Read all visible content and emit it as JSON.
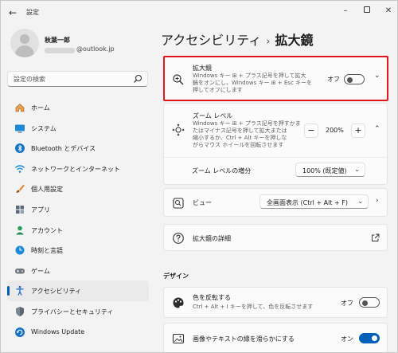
{
  "window": {
    "title": "設定",
    "back_glyph": "←",
    "controls": {
      "minimize": "–",
      "close": "✕"
    }
  },
  "user": {
    "name": "秋葉一郎",
    "email": "@outlook.jp",
    "avatar_icon": "user-avatar-icon"
  },
  "search": {
    "placeholder": "設定の検索",
    "icon": "search-icon"
  },
  "sidebar": {
    "items": [
      {
        "label": "ホーム",
        "icon": "home-icon",
        "active": false
      },
      {
        "label": "システム",
        "icon": "monitor-icon",
        "active": false
      },
      {
        "label": "Bluetooth とデバイス",
        "icon": "bluetooth-icon",
        "active": false
      },
      {
        "label": "ネットワークとインターネット",
        "icon": "wifi-icon",
        "active": false
      },
      {
        "label": "個人用設定",
        "icon": "brush-icon",
        "active": false
      },
      {
        "label": "アプリ",
        "icon": "apps-icon",
        "active": false
      },
      {
        "label": "アカウント",
        "icon": "account-icon",
        "active": false
      },
      {
        "label": "時刻と言語",
        "icon": "globe-clock-icon",
        "active": false
      },
      {
        "label": "ゲーム",
        "icon": "gamepad-icon",
        "active": false
      },
      {
        "label": "アクセシビリティ",
        "icon": "accessibility-icon",
        "active": true
      },
      {
        "label": "プライバシーとセキュリティ",
        "icon": "shield-icon",
        "active": false
      },
      {
        "label": "Windows Update",
        "icon": "update-icon",
        "active": false
      }
    ]
  },
  "breadcrumb": {
    "parent": "アクセシビリティ",
    "separator": "›",
    "current": "拡大鏡"
  },
  "magnifier": {
    "title": "拡大鏡",
    "desc_line1": "Windows キー ⊞ + プラス記号を押して拡大",
    "desc_line2": "鏡をオンにし、Windows キー ⊞ + Esc キーを",
    "desc_line3": "押してオフにします",
    "toggle_label": "オフ",
    "toggle_on": false,
    "chevron": "⌄"
  },
  "zoom": {
    "title": "ズーム レベル",
    "desc_line1": "Windows キー ⊞ + プラス記号を押すかま",
    "desc_line2": "たはマイナス記号を押して拡大または",
    "desc_line3": "縮小するか、Ctrl + Alt キーを押しな",
    "desc_line4": "がらマウス ホイールを回転させます",
    "minus": "−",
    "value": "200%",
    "plus": "+",
    "chevron": "⌃",
    "increment_label": "ズーム レベルの増分",
    "increment_value": "100% (既定値)",
    "dropdown_chevron": "⌄"
  },
  "view": {
    "title": "ビュー",
    "value": "全画面表示 (Ctrl + Alt + F)",
    "dropdown_chevron": "⌄",
    "chevron": "›"
  },
  "details": {
    "title": "拡大鏡の詳細",
    "link_icon": "external-link-icon"
  },
  "design_section": "デザイン",
  "invert": {
    "title": "色を反転する",
    "desc": "Ctrl + Alt + I キーを押して、色を反転させます",
    "toggle_label": "オフ",
    "toggle_on": false
  },
  "smoothing": {
    "title": "画像やテキストの縁を滑らかにする",
    "toggle_label": "オン",
    "toggle_on": true
  },
  "colors": {
    "accent": "#005fb8",
    "highlight": "#e0161b"
  }
}
